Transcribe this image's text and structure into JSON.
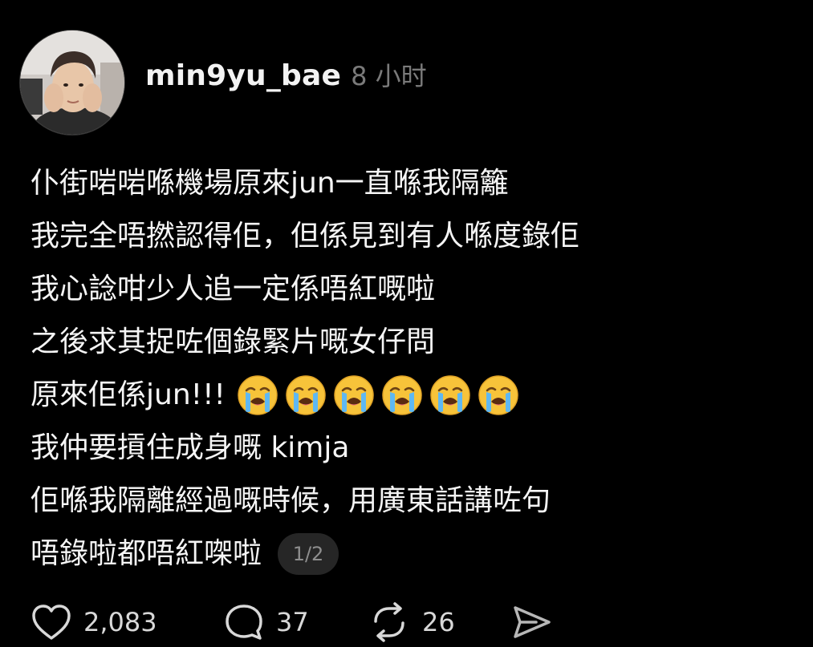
{
  "post": {
    "username": "min9yu_bae",
    "time": "8 小时",
    "lines": [
      "仆街啱啱喺機場原來jun一直喺我隔籬",
      "我完全唔撚認得佢，但係見到有人喺度錄佢",
      "我心諗咁少人追一定係唔紅嘅啦",
      "之後求其捉咗個錄緊片嘅女仔問",
      "原來佢係jun!!!",
      "我仲要摃住成身嘅 kimja",
      "佢喺我隔離經過嘅時候，用廣東話講咗句",
      "唔錄啦都唔紅㗎啦"
    ],
    "emoji_name": "loudly-crying-face",
    "emoji_count": 6,
    "page_indicator": "1/2"
  },
  "actions": {
    "likes": "2,083",
    "replies": "37",
    "reposts": "26"
  },
  "icons": {
    "like": "heart-icon",
    "reply": "comment-bubble-icon",
    "repost": "repost-arrows-icon",
    "share": "send-icon"
  },
  "colors": {
    "background": "#000000",
    "text": "#f5f5f5",
    "muted": "#7a7a7a",
    "badge": "#262626"
  }
}
